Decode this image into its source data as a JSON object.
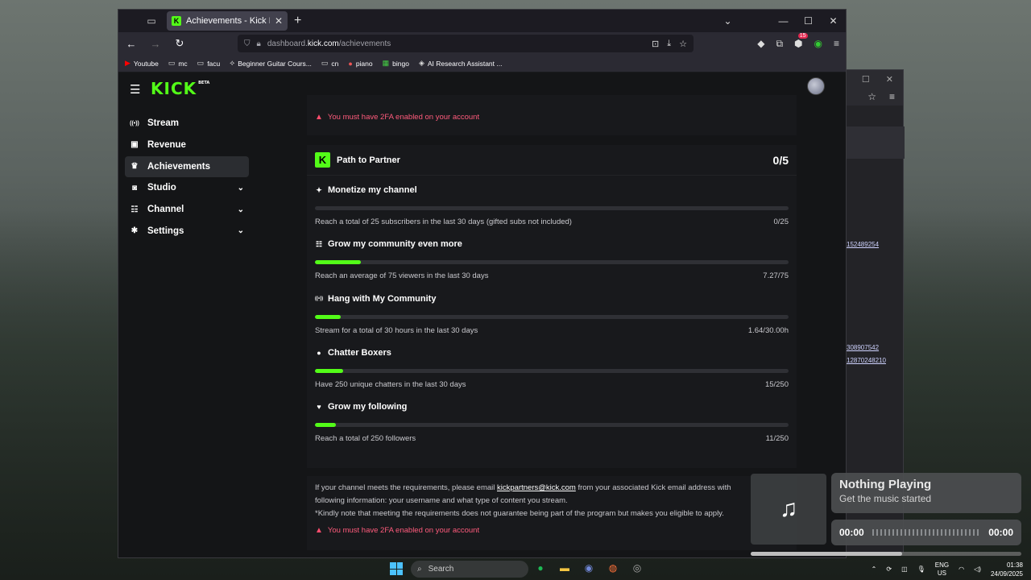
{
  "browser": {
    "tab_title": "Achievements - Kick Dashboard",
    "url_prefix": "dashboard.",
    "url_domain": "kick.com",
    "url_path": "/achievements",
    "extension_badge": "15",
    "bookmarks": [
      {
        "label": "Youtube",
        "icon": "youtube-icon"
      },
      {
        "label": "mc",
        "icon": "folder-icon"
      },
      {
        "label": "facu",
        "icon": "folder-icon"
      },
      {
        "label": "Beginner Guitar Cours...",
        "icon": "link-icon"
      },
      {
        "label": "cn",
        "icon": "folder-icon"
      },
      {
        "label": "piano",
        "icon": "piano-icon"
      },
      {
        "label": "bingo",
        "icon": "bingo-icon"
      },
      {
        "label": "AI Research Assistant ...",
        "icon": "ai-icon"
      }
    ]
  },
  "kick": {
    "logo": "KICK",
    "logo_beta": "BETA",
    "sidebar": [
      {
        "label": "Stream",
        "icon": "stream-icon",
        "active": false,
        "chevron": false
      },
      {
        "label": "Revenue",
        "icon": "revenue-icon",
        "active": false,
        "chevron": false
      },
      {
        "label": "Achievements",
        "icon": "trophy-icon",
        "active": true,
        "chevron": false
      },
      {
        "label": "Studio",
        "icon": "studio-icon",
        "active": false,
        "chevron": true
      },
      {
        "label": "Channel",
        "icon": "channel-icon",
        "active": false,
        "chevron": true
      },
      {
        "label": "Settings",
        "icon": "gear-icon",
        "active": false,
        "chevron": true
      }
    ],
    "top_warning": "You must have 2FA enabled on your account",
    "partner": {
      "title": "Path to Partner",
      "score": "0/5",
      "goals": [
        {
          "title": "Monetize my channel",
          "icon": "sparkle-icon",
          "desc": "Reach a total of 25 subscribers in the last 30 days (gifted subs not included)",
          "value": "0/25",
          "progress": 0.0
        },
        {
          "title": "Grow my community even more",
          "icon": "community-icon",
          "desc": "Reach an average of 75 viewers in the last 30 days",
          "value": "7.27/75",
          "progress": 0.097
        },
        {
          "title": "Hang with My Community",
          "icon": "broadcast-icon",
          "desc": "Stream for a total of 30 hours in the last 30 days",
          "value": "1.64/30.00h",
          "progress": 0.055
        },
        {
          "title": "Chatter Boxers",
          "icon": "chat-icon",
          "desc": "Have 250 unique chatters in the last 30 days",
          "value": "15/250",
          "progress": 0.06
        },
        {
          "title": "Grow my following",
          "icon": "heart-icon",
          "desc": "Reach a total of 250 followers",
          "value": "11/250",
          "progress": 0.044
        }
      ]
    },
    "info": {
      "line1_pre": "If your channel meets the requirements, please email ",
      "email": "kickpartners@kick.com",
      "line1_post": " from your associated Kick email address with",
      "line2": "following information: your username and what type of content you stream.",
      "line3": "*Kindly note that meeting the requirements does not guarantee being part of the program but makes you eligible to apply.",
      "warning": "You must have 2FA enabled on your account"
    }
  },
  "background_window": {
    "links": [
      "152489254",
      "308907542",
      "12870248210"
    ]
  },
  "media": {
    "title": "Nothing Playing",
    "subtitle": "Get the music started",
    "time_start": "00:00",
    "time_end": "00:00",
    "seek": 0.56
  },
  "taskbar": {
    "search_placeholder": "Search",
    "lang_top": "ENG",
    "lang_bottom": "US",
    "time": "01:38",
    "date": "24/09/2025"
  },
  "colors": {
    "kick_green": "#53fc18",
    "warning_red": "#ff5b7c",
    "page_bg": "#141517",
    "card_bg": "#18191c"
  }
}
